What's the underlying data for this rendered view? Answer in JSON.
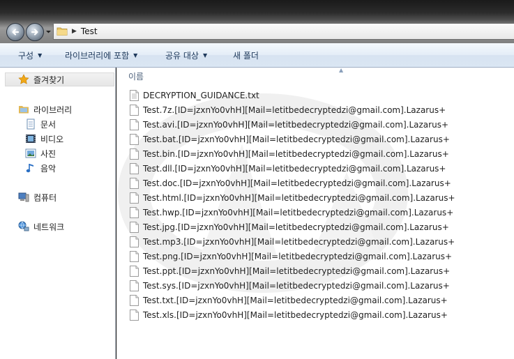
{
  "address": {
    "path": "Test"
  },
  "toolbar": {
    "organize": "구성",
    "include_library": "라이브러리에 포함",
    "share_with": "공유 대상",
    "new_folder": "새 폴더"
  },
  "nav": {
    "favorites": "즐겨찾기",
    "libraries": "라이브러리",
    "documents": "문서",
    "videos": "비디오",
    "pictures": "사진",
    "music": "음악",
    "computer": "컴퓨터",
    "network": "네트워크"
  },
  "column": {
    "name": "이름"
  },
  "files": [
    "DECRYPTION_GUIDANCE.txt",
    "Test.7z.[ID=jzxnYo0vhH][Mail=letitbedecryptedzi@gmail.com].Lazarus+",
    "Test.avi.[ID=jzxnYo0vhH][Mail=letitbedecryptedzi@gmail.com].Lazarus+",
    "Test.bat.[ID=jzxnYo0vhH][Mail=letitbedecryptedzi@gmail.com].Lazarus+",
    "Test.bin.[ID=jzxnYo0vhH][Mail=letitbedecryptedzi@gmail.com].Lazarus+",
    "Test.dll.[ID=jzxnYo0vhH][Mail=letitbedecryptedzi@gmail.com].Lazarus+",
    "Test.doc.[ID=jzxnYo0vhH][Mail=letitbedecryptedzi@gmail.com].Lazarus+",
    "Test.html.[ID=jzxnYo0vhH][Mail=letitbedecryptedzi@gmail.com].Lazarus+",
    "Test.hwp.[ID=jzxnYo0vhH][Mail=letitbedecryptedzi@gmail.com].Lazarus+",
    "Test.jpg.[ID=jzxnYo0vhH][Mail=letitbedecryptedzi@gmail.com].Lazarus+",
    "Test.mp3.[ID=jzxnYo0vhH][Mail=letitbedecryptedzi@gmail.com].Lazarus+",
    "Test.png.[ID=jzxnYo0vhH][Mail=letitbedecryptedzi@gmail.com].Lazarus+",
    "Test.ppt.[ID=jzxnYo0vhH][Mail=letitbedecryptedzi@gmail.com].Lazarus+",
    "Test.sys.[ID=jzxnYo0vhH][Mail=letitbedecryptedzi@gmail.com].Lazarus+",
    "Test.txt.[ID=jzxnYo0vhH][Mail=letitbedecryptedzi@gmail.com].Lazarus+",
    "Test.xls.[ID=jzxnYo0vhH][Mail=letitbedecryptedzi@gmail.com].Lazarus+"
  ],
  "icons": {
    "back": "back-arrow-icon",
    "forward": "forward-arrow-icon",
    "folder": "folder-icon",
    "favorites": "star-icon",
    "libraries": "library-icon",
    "documents": "document-icon",
    "videos": "film-icon",
    "pictures": "picture-icon",
    "music": "music-note-icon",
    "computer": "computer-icon",
    "network": "network-icon",
    "file": "blank-file-icon",
    "text_file": "text-file-icon"
  },
  "colors": {
    "command_text": "#1e395b",
    "header_text": "#4c607a",
    "star": "#f0a818"
  }
}
